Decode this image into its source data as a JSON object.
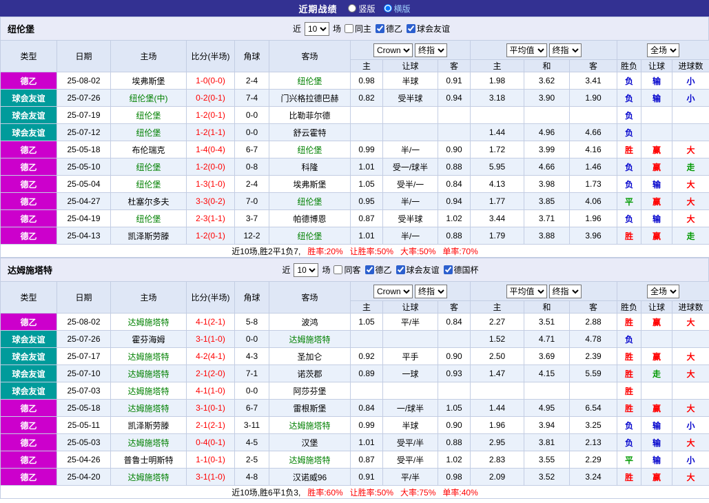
{
  "topbar": {
    "title": "近期战绩",
    "view_options": [
      {
        "label": "竖版",
        "selected": false
      },
      {
        "label": "横版",
        "selected": true
      }
    ]
  },
  "filter_bar": {
    "prefix": "近",
    "suffix": "场"
  },
  "table_header": {
    "col_type": "类型",
    "col_date": "日期",
    "col_home": "主场",
    "col_score": "比分(半场)",
    "col_corner": "角球",
    "col_away": "客场",
    "odds_company": "Crown",
    "odds_stage": "终指",
    "avg_label": "平均值",
    "avg_stage": "终指",
    "full_label": "全场",
    "sub_home": "主",
    "sub_handicap": "让球",
    "sub_away": "客",
    "sub_avg_home": "主",
    "sub_avg_draw": "和",
    "sub_avg_away": "客",
    "col_result": "胜负",
    "col_let": "让球",
    "col_goals": "进球数"
  },
  "type_colors": {
    "德乙": "#cc00cc",
    "球会友谊": "#009b9b"
  },
  "result_colors": {
    "胜": "#ff0000",
    "平": "#009900",
    "负": "#0000cc",
    "赢": "#ff0000",
    "输": "#0000cc",
    "走": "#009900",
    "大": "#ff0000",
    "小": "#0000cc"
  },
  "accent": {
    "score_color": "#ff0000",
    "focal_team_color": "#008000",
    "summary_stat_color": "#ff0000"
  },
  "sections": [
    {
      "title": "纽伦堡",
      "recent_count": "10",
      "filters": [
        {
          "label": "同主",
          "checked": false
        },
        {
          "label": "德乙",
          "checked": true
        },
        {
          "label": "球会友谊",
          "checked": true
        }
      ],
      "rows": [
        {
          "type": "德乙",
          "date": "25-08-02",
          "home": "埃弗斯堡",
          "hf": false,
          "score": "1-0(0-0)",
          "corner": "2-4",
          "away": "纽伦堡",
          "af": true,
          "odds": [
            "0.98",
            "半球",
            "0.91"
          ],
          "avg": [
            "1.98",
            "3.62",
            "3.41"
          ],
          "res": [
            "负",
            "输",
            "小"
          ]
        },
        {
          "type": "球会友谊",
          "date": "25-07-26",
          "home": "纽伦堡(中)",
          "hf": true,
          "score": "0-2(0-1)",
          "corner": "7-4",
          "away": "门兴格拉德巴赫",
          "af": false,
          "odds": [
            "0.82",
            "受半球",
            "0.94"
          ],
          "avg": [
            "3.18",
            "3.90",
            "1.90"
          ],
          "res": [
            "负",
            "输",
            "小"
          ]
        },
        {
          "type": "球会友谊",
          "date": "25-07-19",
          "home": "纽伦堡",
          "hf": true,
          "score": "1-2(0-1)",
          "corner": "0-0",
          "away": "比勒菲尔德",
          "af": false,
          "odds": [
            "",
            "",
            ""
          ],
          "avg": [
            "",
            "",
            ""
          ],
          "res": [
            "负",
            "",
            ""
          ]
        },
        {
          "type": "球会友谊",
          "date": "25-07-12",
          "home": "纽伦堡",
          "hf": true,
          "score": "1-2(1-1)",
          "corner": "0-0",
          "away": "舒云霍特",
          "af": false,
          "odds": [
            "",
            "",
            ""
          ],
          "avg": [
            "1.44",
            "4.96",
            "4.66"
          ],
          "res": [
            "负",
            "",
            ""
          ]
        },
        {
          "type": "德乙",
          "date": "25-05-18",
          "home": "布伦瑞克",
          "hf": false,
          "score": "1-4(0-4)",
          "corner": "6-7",
          "away": "纽伦堡",
          "af": true,
          "odds": [
            "0.99",
            "半/一",
            "0.90"
          ],
          "avg": [
            "1.72",
            "3.99",
            "4.16"
          ],
          "res": [
            "胜",
            "赢",
            "大"
          ]
        },
        {
          "type": "德乙",
          "date": "25-05-10",
          "home": "纽伦堡",
          "hf": true,
          "score": "1-2(0-0)",
          "corner": "0-8",
          "away": "科隆",
          "af": false,
          "odds": [
            "1.01",
            "受一/球半",
            "0.88"
          ],
          "avg": [
            "5.95",
            "4.66",
            "1.46"
          ],
          "res": [
            "负",
            "赢",
            "走"
          ]
        },
        {
          "type": "德乙",
          "date": "25-05-04",
          "home": "纽伦堡",
          "hf": true,
          "score": "1-3(1-0)",
          "corner": "2-4",
          "away": "埃弗斯堡",
          "af": false,
          "odds": [
            "1.05",
            "受半/一",
            "0.84"
          ],
          "avg": [
            "4.13",
            "3.98",
            "1.73"
          ],
          "res": [
            "负",
            "输",
            "大"
          ]
        },
        {
          "type": "德乙",
          "date": "25-04-27",
          "home": "杜塞尔多夫",
          "hf": false,
          "score": "3-3(0-2)",
          "corner": "7-0",
          "away": "纽伦堡",
          "af": true,
          "odds": [
            "0.95",
            "半/一",
            "0.94"
          ],
          "avg": [
            "1.77",
            "3.85",
            "4.06"
          ],
          "res": [
            "平",
            "赢",
            "大"
          ]
        },
        {
          "type": "德乙",
          "date": "25-04-19",
          "home": "纽伦堡",
          "hf": true,
          "score": "2-3(1-1)",
          "corner": "3-7",
          "away": "帕德博恩",
          "af": false,
          "odds": [
            "0.87",
            "受半球",
            "1.02"
          ],
          "avg": [
            "3.44",
            "3.71",
            "1.96"
          ],
          "res": [
            "负",
            "输",
            "大"
          ]
        },
        {
          "type": "德乙",
          "date": "25-04-13",
          "home": "凯泽斯劳滕",
          "hf": false,
          "score": "1-2(0-1)",
          "corner": "12-2",
          "away": "纽伦堡",
          "af": true,
          "odds": [
            "1.01",
            "半/一",
            "0.88"
          ],
          "avg": [
            "1.79",
            "3.88",
            "3.96"
          ],
          "res": [
            "胜",
            "赢",
            "走"
          ]
        }
      ],
      "summary": {
        "lead": "近10场,胜2平1负7,",
        "stats": [
          "胜率:20%",
          "让胜率:50%",
          "大率:50%",
          "单率:70%"
        ]
      }
    },
    {
      "title": "达姆施塔特",
      "recent_count": "10",
      "filters": [
        {
          "label": "同客",
          "checked": false
        },
        {
          "label": "德乙",
          "checked": true
        },
        {
          "label": "球会友谊",
          "checked": true
        },
        {
          "label": "德国杯",
          "checked": true
        }
      ],
      "rows": [
        {
          "type": "德乙",
          "date": "25-08-02",
          "home": "达姆施塔特",
          "hf": true,
          "score": "4-1(2-1)",
          "corner": "5-8",
          "away": "波鸿",
          "af": false,
          "odds": [
            "1.05",
            "平/半",
            "0.84"
          ],
          "avg": [
            "2.27",
            "3.51",
            "2.88"
          ],
          "res": [
            "胜",
            "赢",
            "大"
          ]
        },
        {
          "type": "球会友谊",
          "date": "25-07-26",
          "home": "霍芬海姆",
          "hf": false,
          "score": "3-1(1-0)",
          "corner": "0-0",
          "away": "达姆施塔特",
          "af": true,
          "odds": [
            "",
            "",
            ""
          ],
          "avg": [
            "1.52",
            "4.71",
            "4.78"
          ],
          "res": [
            "负",
            "",
            ""
          ]
        },
        {
          "type": "球会友谊",
          "date": "25-07-17",
          "home": "达姆施塔特",
          "hf": true,
          "score": "4-2(4-1)",
          "corner": "4-3",
          "away": "圣加仑",
          "af": false,
          "odds": [
            "0.92",
            "平手",
            "0.90"
          ],
          "avg": [
            "2.50",
            "3.69",
            "2.39"
          ],
          "res": [
            "胜",
            "赢",
            "大"
          ]
        },
        {
          "type": "球会友谊",
          "date": "25-07-10",
          "home": "达姆施塔特",
          "hf": true,
          "score": "2-1(2-0)",
          "corner": "7-1",
          "away": "诺茨郡",
          "af": false,
          "odds": [
            "0.89",
            "一球",
            "0.93"
          ],
          "avg": [
            "1.47",
            "4.15",
            "5.59"
          ],
          "res": [
            "胜",
            "走",
            "大"
          ]
        },
        {
          "type": "球会友谊",
          "date": "25-07-03",
          "home": "达姆施塔特",
          "hf": true,
          "score": "4-1(1-0)",
          "corner": "0-0",
          "away": "阿莎芬堡",
          "af": false,
          "odds": [
            "",
            "",
            ""
          ],
          "avg": [
            "",
            "",
            ""
          ],
          "res": [
            "胜",
            "",
            ""
          ]
        },
        {
          "type": "德乙",
          "date": "25-05-18",
          "home": "达姆施塔特",
          "hf": true,
          "score": "3-1(0-1)",
          "corner": "6-7",
          "away": "雷根斯堡",
          "af": false,
          "odds": [
            "0.84",
            "一/球半",
            "1.05"
          ],
          "avg": [
            "1.44",
            "4.95",
            "6.54"
          ],
          "res": [
            "胜",
            "赢",
            "大"
          ]
        },
        {
          "type": "德乙",
          "date": "25-05-11",
          "home": "凯泽斯劳滕",
          "hf": false,
          "score": "2-1(2-1)",
          "corner": "3-11",
          "away": "达姆施塔特",
          "af": true,
          "odds": [
            "0.99",
            "半球",
            "0.90"
          ],
          "avg": [
            "1.96",
            "3.94",
            "3.25"
          ],
          "res": [
            "负",
            "输",
            "小"
          ]
        },
        {
          "type": "德乙",
          "date": "25-05-03",
          "home": "达姆施塔特",
          "hf": true,
          "score": "0-4(0-1)",
          "corner": "4-5",
          "away": "汉堡",
          "af": false,
          "odds": [
            "1.01",
            "受平/半",
            "0.88"
          ],
          "avg": [
            "2.95",
            "3.81",
            "2.13"
          ],
          "res": [
            "负",
            "输",
            "大"
          ]
        },
        {
          "type": "德乙",
          "date": "25-04-26",
          "home": "普鲁士明斯特",
          "hf": false,
          "score": "1-1(0-1)",
          "corner": "2-5",
          "away": "达姆施塔特",
          "af": true,
          "odds": [
            "0.87",
            "受平/半",
            "1.02"
          ],
          "avg": [
            "2.83",
            "3.55",
            "2.29"
          ],
          "res": [
            "平",
            "输",
            "小"
          ]
        },
        {
          "type": "德乙",
          "date": "25-04-20",
          "home": "达姆施塔特",
          "hf": true,
          "score": "3-1(1-0)",
          "corner": "4-8",
          "away": "汉诺威96",
          "af": false,
          "odds": [
            "0.91",
            "平/半",
            "0.98"
          ],
          "avg": [
            "2.09",
            "3.52",
            "3.24"
          ],
          "res": [
            "胜",
            "赢",
            "大"
          ]
        }
      ],
      "summary": {
        "lead": "近10场,胜6平1负3,",
        "stats": [
          "胜率:60%",
          "让胜率:50%",
          "大率:75%",
          "单率:40%"
        ]
      }
    }
  ]
}
